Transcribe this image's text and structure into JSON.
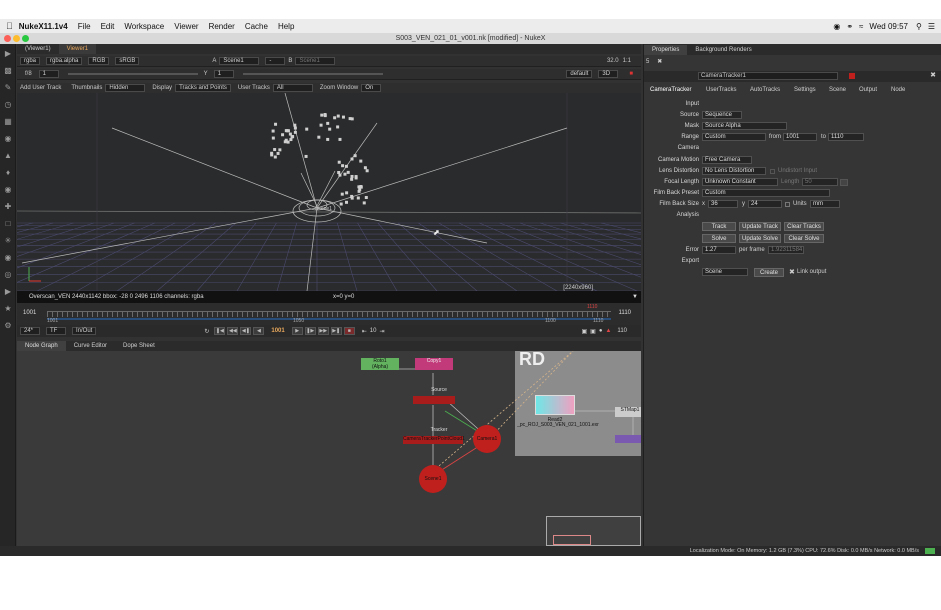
{
  "menubar": {
    "app_name": "NukeX11.1v4",
    "items": [
      "File",
      "Edit",
      "Workspace",
      "Viewer",
      "Render",
      "Cache",
      "Help"
    ],
    "clock": "Wed 09:57"
  },
  "window": {
    "title": "S003_VEN_021_01_v001.nk [modified] - NukeX"
  },
  "viewer": {
    "tabs": [
      "(Viewer1)",
      "Viewer1"
    ],
    "channels": "rgba",
    "alpha": "rgba.alpha",
    "colorspace": "RGB",
    "lut": "sRGB",
    "input_a": "Scene1",
    "input_b": "Scene1",
    "zoom": "1:1",
    "fstop": "f/8",
    "gain": "1",
    "y_label": "Y",
    "y_value": "1",
    "mode_3d": "3D",
    "default_label": "default",
    "gamma_value": "32.0",
    "tracker_bar": {
      "add_user_track": "Add User Track",
      "thumbnails_label": "Thumbnails",
      "thumbnails_value": "Hidden",
      "display_label": "Display",
      "display_value": "Tracks and Points",
      "user_tracks_label": "User Tracks",
      "user_tracks_value": "All",
      "zoom_window_label": "Zoom Window",
      "zoom_window_value": "On"
    },
    "format_label": "[2240x960]",
    "node_label": "Scene1",
    "info": "Overscan_VEN 2440x1142  bbox: -28 0 2496 1106 channels: rgba",
    "coords": "x=0 y=0"
  },
  "timeline": {
    "start": "1001",
    "end": "1110",
    "ticks": [
      "1001",
      "1050",
      "1100",
      "1110"
    ],
    "current_marker": "1110",
    "fps": "24*",
    "tf": "TF",
    "inout": "In/Out",
    "current_frame": "1001",
    "step": "10",
    "end_frame_display": "110"
  },
  "lower_tabs": [
    "Node Graph",
    "Curve Editor",
    "Dope Sheet"
  ],
  "nodegraph": {
    "nodes": {
      "roto": "Roto1\n(Alpha)",
      "copy": "Copy1",
      "source": "Source",
      "tracker": "Tracker",
      "camera_tracker": "CameraTrackerPointCloud1",
      "camera": "Camera1",
      "scene": "Scene1",
      "read": "Read2",
      "read_file": "_pc_ROJ_S003_VEN_021_1001.exr",
      "stmap": "STMap1",
      "rd_label": "RD"
    }
  },
  "properties": {
    "tabs": [
      "Properties",
      "Background Renders"
    ],
    "node_name": "CameraTracker1",
    "subtabs": [
      "CameraTracker",
      "UserTracks",
      "AutoTracks",
      "Settings",
      "Scene",
      "Output",
      "Node"
    ],
    "input_header": "Input",
    "source_label": "Source",
    "source_value": "Sequence",
    "mask_label": "Mask",
    "mask_value": "Source Alpha",
    "range_label": "Range",
    "range_value": "Custom",
    "from_label": "from",
    "from_value": "1001",
    "to_label": "to",
    "to_value": "1110",
    "camera_header": "Camera",
    "camera_motion_label": "Camera Motion",
    "camera_motion_value": "Free Camera",
    "undistort_label": "Undistort Input",
    "lens_label": "Lens Distortion",
    "lens_value": "No Lens Distortion",
    "focal_label": "Focal Length",
    "focal_value": "Unknown Constant",
    "length_label": "Length",
    "length_value": "50",
    "filmback_preset_label": "Film Back Preset",
    "filmback_preset_value": "Custom",
    "filmback_size_label": "Film Back Size",
    "x_label": "x",
    "x_value": "36",
    "y_label": "y",
    "y_value": "24",
    "units_label": "Units",
    "units_value": "mm",
    "analysis_header": "Analysis",
    "track_btn": "Track",
    "update_track_btn": "Update Track",
    "clear_tracks_btn": "Clear Tracks",
    "solve_btn": "Solve",
    "update_solve_btn": "Update Solve",
    "clear_solve_btn": "Clear Solve",
    "error_label": "Error",
    "error_value": "1.27",
    "per_frame_label": "per frame",
    "per_frame_value": "1.92311584",
    "export_header": "Export",
    "export_value": "Scene",
    "create_btn": "Create",
    "link_output_label": "Link output"
  },
  "status": {
    "text": "Localization Mode: On  Memory: 1.2 GB (7.3%)  CPU: 72.6%  Disk: 0.0 MB/s  Network: 0.0 MB/s"
  },
  "colors": {
    "accent_orange": "#e8a85c",
    "node_red": "#c0201d",
    "node_green": "#62b25f",
    "node_pink": "#c33a7a"
  }
}
